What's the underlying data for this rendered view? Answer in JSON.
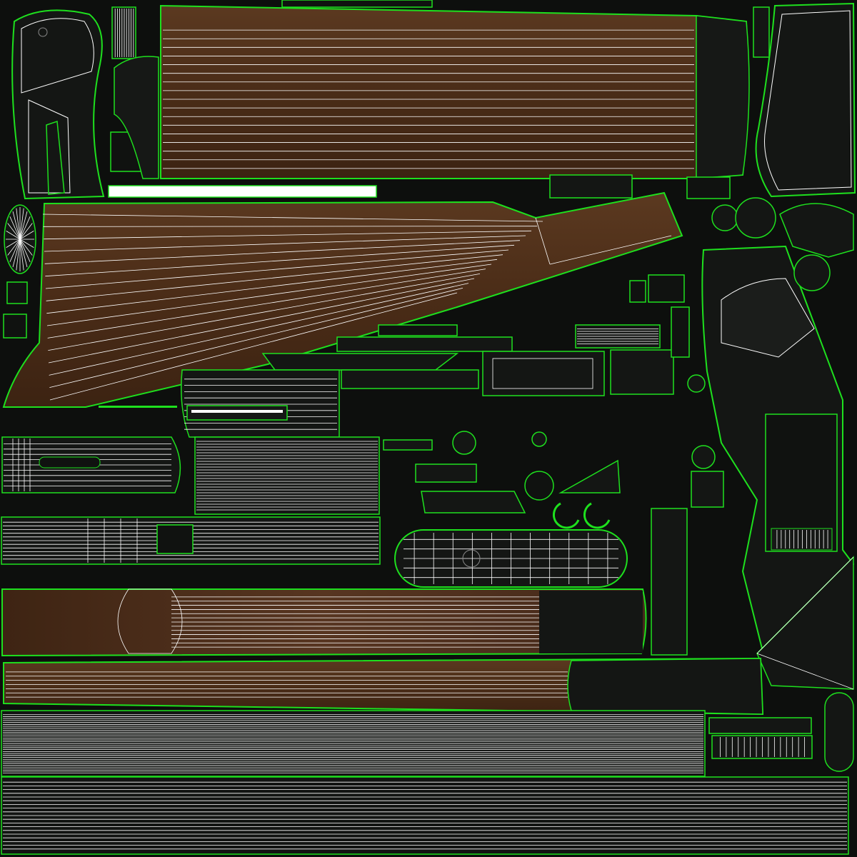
{
  "atlas": {
    "background_color": "#0d0f0d",
    "wood_color": "#4a2c18",
    "wood_light_color": "#5a3820",
    "dark_metal_color": "#141614",
    "seam_color": "#1ee01e",
    "wire_color": "#ffffff"
  }
}
